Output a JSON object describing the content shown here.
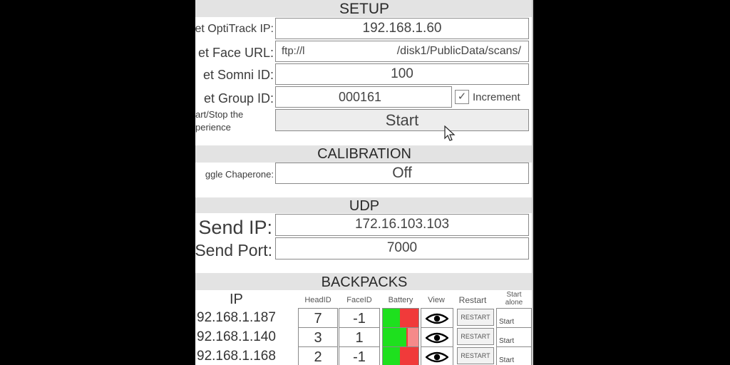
{
  "setup": {
    "heading": "SETUP",
    "optitrack_label": "et OptiTrack IP:",
    "optitrack_value": "192.168.1.60",
    "face_url_label": "et Face URL:",
    "face_url_prefix": "ftp://l",
    "face_url_suffix": "/disk1/PublicData/scans/",
    "somni_label": "et Somni ID:",
    "somni_value": "100",
    "group_label": "et Group ID:",
    "group_value": "000161",
    "increment_label": "Increment",
    "increment_checked": true,
    "startstop_label_1": "art/Stop the",
    "startstop_label_2": "perience",
    "start_button": "Start"
  },
  "calibration": {
    "heading": "CALIBRATION",
    "chaperone_label": "ggle Chaperone:",
    "chaperone_value": "Off"
  },
  "udp": {
    "heading": "UDP",
    "send_ip_label": "Send IP:",
    "send_ip_value": "172.16.103.103",
    "send_port_label": "Send Port:",
    "send_port_value": "7000"
  },
  "backpacks": {
    "heading": "BACKPACKS",
    "columns": {
      "ip": "IP",
      "headid": "HeadID",
      "faceid": "FaceID",
      "battery": "Battery",
      "view": "View",
      "restart": "Restart",
      "start_alone_1": "Start",
      "start_alone_2": "alone"
    },
    "rows": [
      {
        "ip": "92.168.1.187",
        "headid": "7",
        "faceid": "-1",
        "battery_level": 0.48,
        "restart": "RESTART",
        "start": "Start"
      },
      {
        "ip": "92.168.1.140",
        "headid": "3",
        "faceid": "1",
        "battery_level": 0.66,
        "restart": "RESTART",
        "start": "Start"
      },
      {
        "ip": "92.168.1.168",
        "headid": "2",
        "faceid": "-1",
        "battery_level": 0.48,
        "restart": "RESTART",
        "start": "Start"
      }
    ]
  }
}
